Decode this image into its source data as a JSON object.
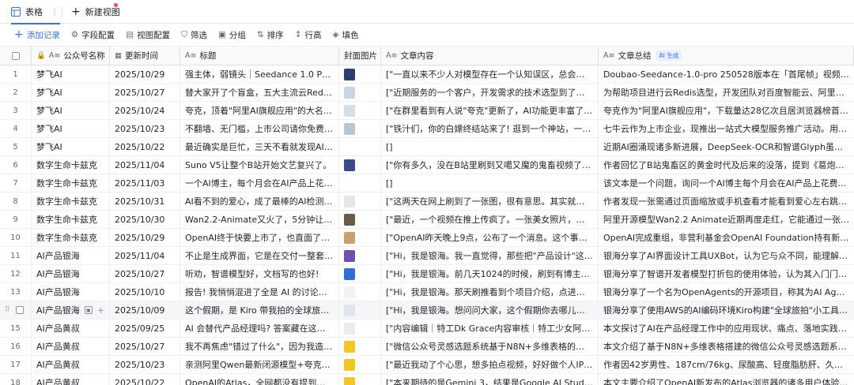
{
  "tabs": {
    "active_label": "表格",
    "new_label": "新建视图"
  },
  "toolbar": {
    "add_record": "添加记录",
    "field_config": "字段配置",
    "view_config": "视图配置",
    "filter": "筛选",
    "group": "分组",
    "sort": "排序",
    "row_height": "行高",
    "fill": "填色"
  },
  "columns": {
    "account": "公众号名称",
    "updated": "更新时间",
    "title": "标题",
    "cover": "封面图片",
    "content": "文章内容",
    "summary": "文章总结",
    "ai_tag": "AI 生成"
  },
  "rows": [
    {
      "n": "1",
      "account": "梦飞AI",
      "date": "2025/10/29",
      "title": "强主体，弱镜头｜Seedance 1.0 Pro首尾...",
      "cover": "#2c3e70",
      "content": "[\"一直以来不少人对模型存在一个认知误区，总会在问:...",
      "summary": "Doubao-Seedance-1.0-pro 250528版本在「首尾帧」视频生成方面，..."
    },
    {
      "n": "2",
      "account": "梦飞AI",
      "date": "2025/10/27",
      "title": "替大家开了个盲盒，五大主流云Redis实...",
      "cover": "#c9d3e6",
      "content": "[\"近期服务的一个客户，开发需求的技术选型到了关键节...",
      "summary": "为帮助项目进行云Redis选型，开发团队对百度智能云、阿里云、腾讯..."
    },
    {
      "n": "3",
      "account": "梦飞AI",
      "date": "2025/10/24",
      "title": "夸克，顶着\"阿里AI旗舰应用\"的大名，成...",
      "cover": "#d8dde6",
      "content": "[\"在群里看到有人说\"夸克\"更新了，AI功能更丰富了。但我...",
      "summary": "夸克作为\"阿里AI旗舰应用\"，下载量达28亿次且居浏览器榜首位。其..."
    },
    {
      "n": "4",
      "account": "梦飞AI",
      "date": "2025/10/23",
      "title": "不翻墙、无门槛，上市公司请你免费用...",
      "cover": "#b9c4d6",
      "content": "[\"铁汁们，你的白嫖终结站来了! 逛到一个神站，一通操...",
      "summary": "七牛云作为上市企业，现推出一站式大模型服务推广活动。用户通过..."
    },
    {
      "n": "5",
      "account": "梦飞AI",
      "date": "2025/10/22",
      "title": "最近确实是巨忙，三天不看就发现AI圈...",
      "cover": "",
      "content": "[]",
      "summary": "近期AI圈涌现诸多新进展，DeepSeek-OCR和智谱Glyph虽方法不同，..."
    },
    {
      "n": "6",
      "account": "数字生命卡兹克",
      "date": "2025/11/04",
      "title": "Suno V5让整个B站开始文艺复兴了。",
      "cover": "#3b4b8a",
      "content": "[\"你有多久，没在B站里刷到又噶又魔的鬼畜视频了? 讲道...",
      "summary": "作者回忆了B站鬼畜区的黄金时代及后来的没落，提到《葛炮的号哭》..."
    },
    {
      "n": "7",
      "account": "数字生命卡兹克",
      "date": "2025/11/03",
      "title": "一个AI博主，每个月会在AI产品上花多少...",
      "cover": "",
      "content": "[]",
      "summary": "该文本是一个问题，询问一个AI博主每个月会在AI产品上花费多少钱。"
    },
    {
      "n": "8",
      "account": "数字生命卡兹克",
      "date": "2025/10/31",
      "title": "AI看不到的爱心，成了最棒的AI检测器。",
      "cover": "#e6e6e6",
      "content": "[\"这两天在网上刷到了一张图，很有意思。其实就是一张...",
      "summary": "作者发现一张需通过页面缩放或手机查看才能看到爱心左右跳动的视..."
    },
    {
      "n": "9",
      "account": "数字生命卡兹克",
      "date": "2025/10/30",
      "title": "Wan2.2-Animate又火了，5分钟让抠脚大...",
      "cover": "#6a5a4a",
      "content": "[\"最近，一个视频在推上传疯了。一张美女照片，加上一...",
      "summary": "阿里开源模型Wan2.2 Animate近期再度走红，它能通过一张照片和一..."
    },
    {
      "n": "10",
      "account": "数字生命卡兹克",
      "date": "2025/10/29",
      "title": "OpenAI终于快要上市了，也直面了这23...",
      "cover": "#c8a06a",
      "content": "[\"OpenAI昨天晚上9点，公布了一个消息。这个事，影响还...",
      "summary": "OpenAI完成重组，非营利基金会OpenAI Foundation持有新营利公司O..."
    },
    {
      "n": "11",
      "account": "AI产品银海",
      "date": "2025/11/04",
      "title": "不止是生成界面，它是在交付一整套产...",
      "cover": "#6b4fb5",
      "content": "[\"Hi，我是银海。我一直觉得，那些把\"产品设计\"这件事真...",
      "summary": "银海分享了AI界面设计工具UXBot，认为它与众不同，能理解产品设计..."
    },
    {
      "n": "12",
      "account": "AI产品银海",
      "date": "2025/10/27",
      "title": "听劝，智谱模型好，文档写的也好!",
      "cover": "#2f6fd6",
      "content": "[\"Hi，我是银海。前几天1024的时候，刷到有博主推荐了...",
      "summary": "银海分享了智谱开发者模型打折包的使用体验，认为其入门门槛低（2..."
    },
    {
      "n": "13",
      "account": "AI产品银海",
      "date": "2025/10/10",
      "title": "报告! 我悄悄混进了全是 AI 的讨论组...",
      "cover": "#f2f2f2",
      "content": "[\"Hi，我是银海。那天刷推看到个项目介绍，点进去还没看...",
      "summary": "银海分享了一个名为OpenAgents的开源项目，称其为AI Agent协作框..."
    },
    {
      "n": "14",
      "account": "AI产品银海",
      "date": "2025/10/09",
      "title": "这个假期，是 Kiro 带我拍的全球旅游照。",
      "cover": "#dfe4ee",
      "content": "[\"Hi，我是银海。想问问大家，这个假期你去哪儿玩了? 是...",
      "summary": "银海分享了使用AWS的AI编码环境Kiro构建\"全球旅拍\"小工具的经历。..."
    },
    {
      "n": "15",
      "account": "AI产品黄叔",
      "date": "2025/09/25",
      "title": "AI 会替代产品经理吗? 答案藏在这份白...",
      "cover": "#ececec",
      "content": "[\"内容编辑｜特工Dk Grace内容审核｜特工少女阿里 CEO ...",
      "summary": "本文探讨了AI在产品经理工作中的应用现状、痛点、落地实践及职业..."
    },
    {
      "n": "16",
      "account": "AI产品黄叔",
      "date": "2025/10/27",
      "title": "我不再焦虑\"错过了什么\"，因为我造了个...",
      "cover": "#f3c623",
      "content": "[\"微信公众号灵感选题系统基于N8N+多维表格的自动信息...",
      "summary": "本文介绍了基于N8N+多维表格搭建的微信公众号灵感选题系统。因黄..."
    },
    {
      "n": "17",
      "account": "AI产品黄叔",
      "date": "2025/10/23",
      "title": "亲测阿里Qwen最新闭源模型+夸克最全...",
      "cover": "#f3c623",
      "content": "[\"最近我动了个心思，想多拍点视频，好好做个人IP。毕竟...",
      "summary": "作者因42岁男性、187cm/76kg、尿酸高、轻度脂肪肝、久坐办公且上..."
    },
    {
      "n": "18",
      "account": "AI产品黄叔",
      "date": "2025/10/22",
      "title": "OpenAI的Atlas，全网都没有提到的产品...",
      "cover": "#f3c623",
      "content": "[\"本来期待的是Gemini 3，结果是Google AI Studio的build ...",
      "summary": "本文主要介绍了OpenAI新发布的Atlas浏览器的诸多用户体验细节。其..."
    }
  ]
}
